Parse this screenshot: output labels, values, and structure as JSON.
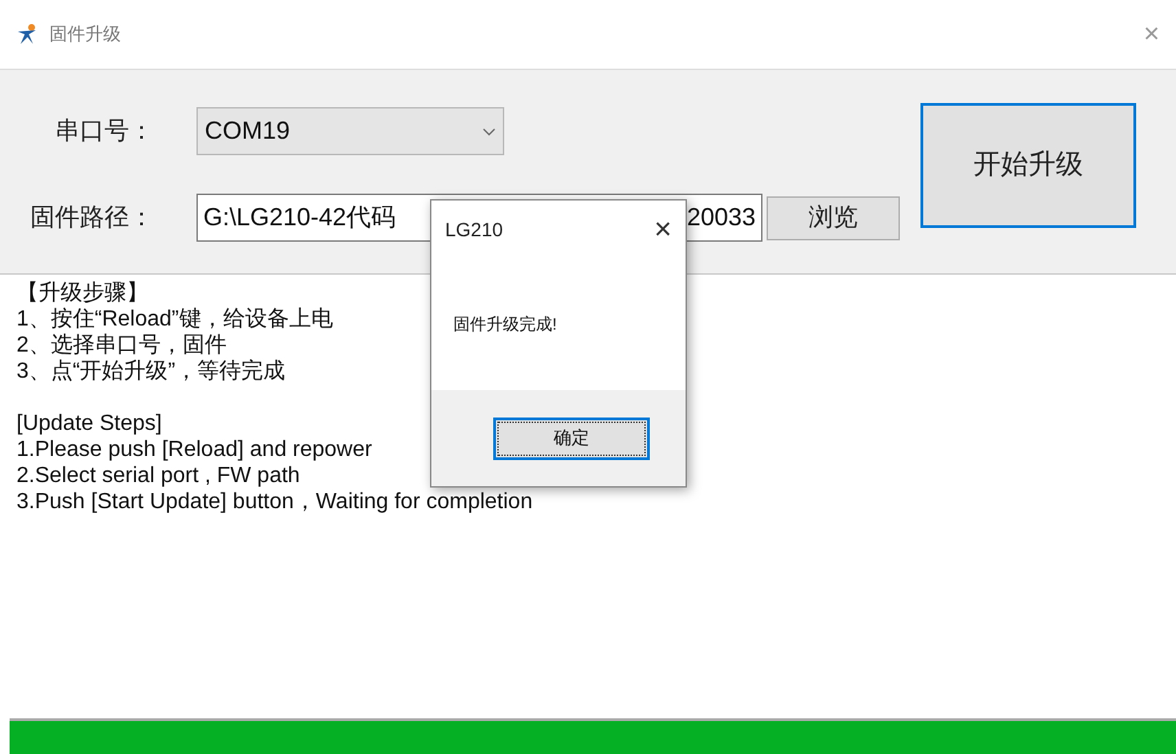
{
  "window": {
    "title": "固件升级",
    "close": "×"
  },
  "form": {
    "port_label": "串口号：",
    "port_value": "COM19",
    "path_label": "固件路径：",
    "path_value_start": "G:\\LG210-42代码",
    "path_value_end": "20033",
    "browse_button": "浏览",
    "start_button": "开始升级",
    "start_focused": true
  },
  "instructions": [
    [
      "【升级步骤】",
      "1、按住“Reload”键，给设备上电",
      "2、选择串口号，固件",
      "3、点“开始升级”，等待完成"
    ],
    [
      "[Update Steps]",
      "1.Please push [Reload] and repower",
      "2.Select serial port , FW path",
      "3.Push [Start Update] button，Waiting for completion"
    ]
  ],
  "progress": {
    "level": 1
  },
  "dialog": {
    "title": "LG210",
    "close": "×",
    "message": "固件升级完成!",
    "ok_button": "确定"
  }
}
